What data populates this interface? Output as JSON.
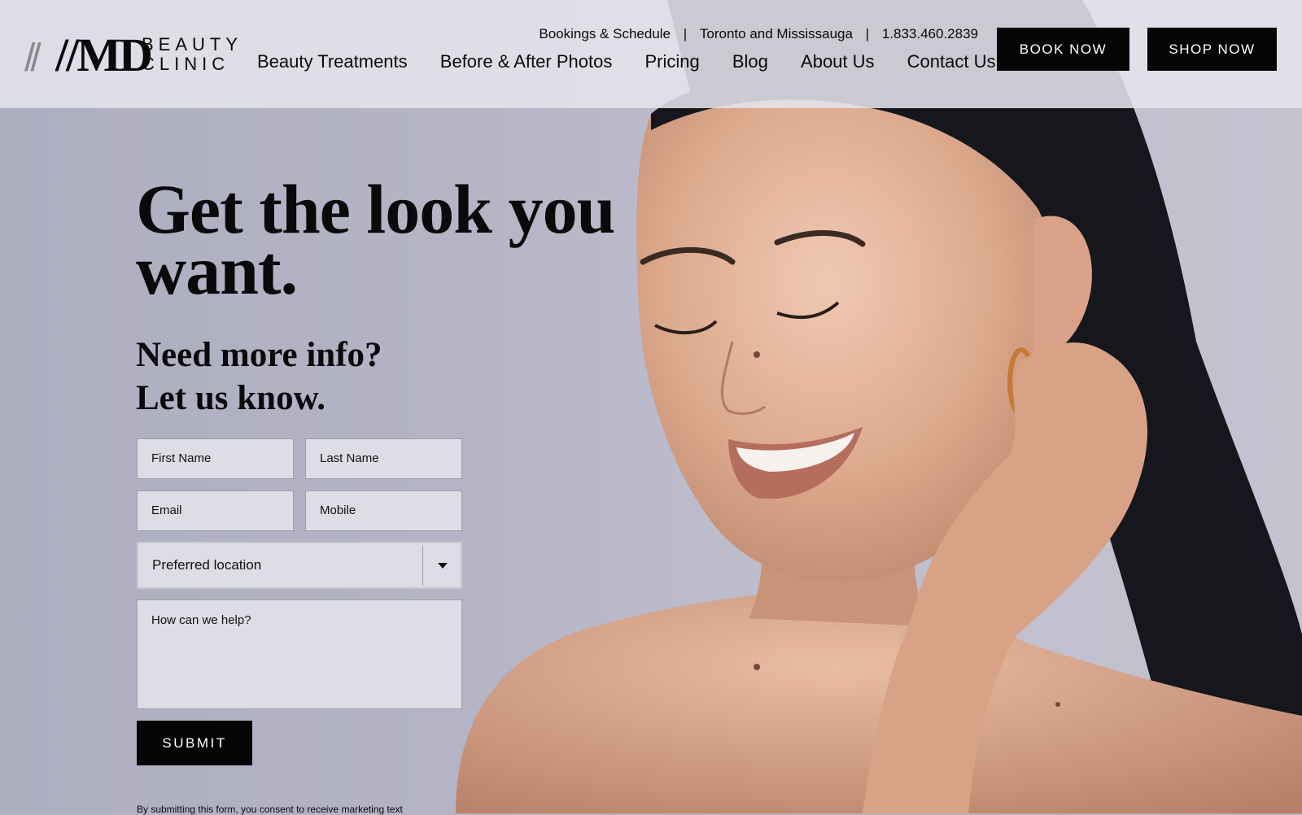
{
  "header": {
    "logo": {
      "mark": "//MD",
      "line1": "BEAUTY",
      "line2": "CLINIC"
    },
    "utility": {
      "bookings": "Bookings & Schedule",
      "separator": "|",
      "locations": "Toronto and Mississauga",
      "phone": "1.833.460.2839"
    },
    "nav": [
      "Beauty Treatments",
      "Before & After Photos",
      "Pricing",
      "Blog",
      "About Us",
      "Contact Us"
    ],
    "book_button": "BOOK NOW",
    "shop_button": "SHOP NOW"
  },
  "hero": {
    "headline_line1": "Get the look you",
    "headline_line2": "want.",
    "subhead_line1": "Need more info?",
    "subhead_line2": "Let us know."
  },
  "form": {
    "first_name": "First Name",
    "last_name": "Last Name",
    "email": "Email",
    "mobile": "Mobile",
    "location": "Preferred location",
    "message": "How can we help?",
    "submit": "SUBMIT",
    "consent": "By submitting this form, you consent to receive marketing text"
  },
  "colors": {
    "button_bg": "#050505",
    "header_bg": "#e4e4ec",
    "hero_bg": "#b3b3c4"
  }
}
